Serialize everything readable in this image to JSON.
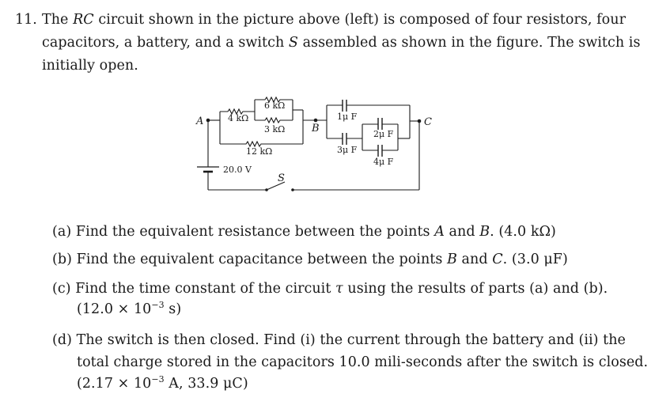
{
  "problem": {
    "number": "11.",
    "intro_lines": [
      [
        "The ",
        {
          "i": "RC"
        },
        " circuit shown in the picture above (left) is composed of four resistors, four"
      ],
      [
        "capacitors, a battery, and a switch ",
        {
          "i": "S"
        },
        " assembled as shown in the figure. The switch is"
      ],
      [
        "initially open."
      ]
    ],
    "intro_text": "The RC circuit shown in the picture above (left) is composed of four resistors, four capacitors, a battery, and a switch S assembled as shown in the figure. The switch is initially open."
  },
  "circuit": {
    "nodes": {
      "A": "A",
      "B": "B",
      "C": "C"
    },
    "resistors": [
      "4 kΩ",
      "6 kΩ",
      "3 kΩ",
      "12 kΩ"
    ],
    "capacitors": [
      "1μ F",
      "2μ F",
      "3μ F",
      "4μ F"
    ],
    "battery": "20.0 V",
    "switch": "S"
  },
  "parts": [
    {
      "label": "(a)",
      "text": "Find the equivalent resistance between the points A and B.",
      "answer": "(4.0 kΩ)"
    },
    {
      "label": "(b)",
      "text": "Find the equivalent capacitance between the points B and C.",
      "answer": "(3.0 μF)"
    },
    {
      "label": "(c)",
      "text": "Find the time constant of the circuit τ using the results of parts (a) and (b).",
      "answer": "(12.0 × 10⁻³ s)"
    },
    {
      "label": "(d)",
      "text": "The switch is then closed. Find (i) the current through the battery and (ii) the total charge stored in the capacitors 10.0 mili-seconds after the switch is closed.",
      "answer": "(2.17 × 10⁻³ A, 33.9 μC)"
    }
  ],
  "part_text": {
    "a": {
      "pre": "Find the equivalent resistance between the points ",
      "v1": "A",
      "mid": " and ",
      "v2": "B",
      "post": ". (4.0 kΩ)"
    },
    "b": {
      "pre": "Find the equivalent capacitance between the points ",
      "v1": "B",
      "mid": " and ",
      "v2": "C",
      "post": ". (3.0 μF)"
    },
    "c": {
      "line1_pre": "Find the time constant of the circuit ",
      "tau": "τ",
      "line1_post": " using the results of parts (a) and (b).",
      "line2_pre": "(12.0 × 10",
      "exp": "−3",
      "line2_post": " s)"
    },
    "d": {
      "line1": "The switch is then closed.  Find (i) the current through the battery and (ii) the",
      "line2": "total charge stored in the capacitors 10.0 mili-seconds after the switch is closed.",
      "line3_pre": "(2.17 × 10",
      "exp": "−3",
      "line3_post": " A, 33.9 μC)"
    }
  }
}
